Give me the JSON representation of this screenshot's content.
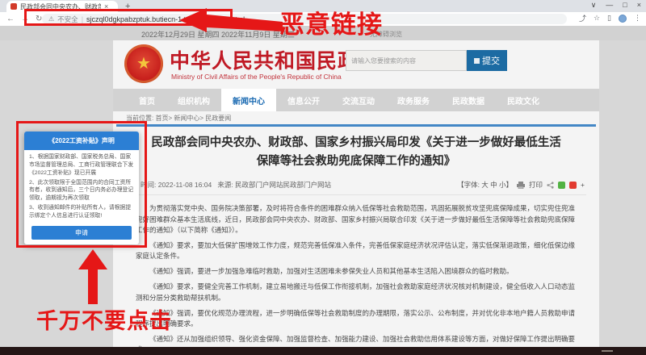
{
  "browser": {
    "tab": {
      "title": "民政部会同中央农办、财政部、",
      "close_icon": "×",
      "new_tab_icon": "+"
    },
    "window_controls": {
      "chevron": "∨",
      "minimize": "—",
      "maximize": "□",
      "close": "×"
    },
    "toolbar": {
      "back_icon": "←",
      "forward_icon": "→",
      "reload_icon": "↻",
      "warning_icon": "⚠",
      "security_label": "不安全",
      "divider": "|",
      "url": "sjczql0dgkpabzptuk.butiecn-1.top/gzbt/index.html",
      "share_icon": "⤴",
      "bookmark_icon": "☆",
      "sidebar_icon": "▯",
      "menu_icon": "⋮"
    }
  },
  "annotations": {
    "malicious_link": "恶意链接",
    "do_not_click": "千万不要点击"
  },
  "datebar": {
    "dates": "2022年12月29日 星期四 2022年11月9日 星期三",
    "accessibility_label": "无障碍浏览"
  },
  "site": {
    "emblem_star": "★",
    "title_cn": "中华人民共和国民政部",
    "title_en": "Ministry of Civil Affairs of the People's Republic of China",
    "search": {
      "placeholder": "请输入您要搜索的内容",
      "submit": "提交"
    }
  },
  "nav": {
    "items": [
      {
        "label": "首页"
      },
      {
        "label": "组织机构"
      },
      {
        "label": "新闻中心"
      },
      {
        "label": "信息公开"
      },
      {
        "label": "交流互动"
      },
      {
        "label": "政务服务"
      },
      {
        "label": "民政数据"
      },
      {
        "label": "民政文化"
      }
    ],
    "active_label": "新闻中心"
  },
  "breadcrumb": "当前位置: 首页> 新闻中心> 民政要闻",
  "article": {
    "title": "民政部会同中央农办、财政部、国家乡村振兴局印发《关于进一步做好最低生活保障等社会救助兜底保障工作的通知》",
    "time": "时间: 2022-11-08 16:04",
    "source": "来源: 民政部门户网站民政部门户网站",
    "font_size_label": "【字体: 大 中 小】",
    "print_label": "打印",
    "share_plus": "+",
    "paragraphs": [
      "为贯彻落实党中央、国务院决策部署，及时将符合条件的困难群众纳入低保等社会救助范围，巩固拓展脱贫攻坚兜底保障成果，切实兜住兜准兜好困难群众基本生活底线，近日，民政部会同中央农办、财政部、国家乡村振兴局联合印发《关于进一步做好最低生活保障等社会救助兜底保障工作的通知》（以下简称《通知》）。",
      "《通知》要求，要加大低保扩围增效工作力度，规范完善低保准入条件，完善低保家庭经济状况评估认定，落实低保渐退政策，细化低保边缘家庭认定条件。",
      "《通知》强调，要进一步加强急难临时救助，加强对生活困难未参保失业人员和其他基本生活陷入困境群众的临时救助。",
      "《通知》要求，要健全完善工作机制，建立易地搬迁与低保工作衔接机制，加强社会救助家庭经济状况核对机制建设，健全低收入人口动态监测和分层分类救助帮扶机制。",
      "《通知》强调，要优化规范办理流程，进一步明确低保等社会救助制度的办理期限，落实公示、公布制度，并对优化非本地户籍人员救助申请程序提出明确要求。",
      "《通知》还从加强组织领导、强化资金保障、加强监督检查、加强能力建设、加强社会救助信用体系建设等方面，对做好保障工作提出明确要求。"
    ]
  },
  "dialog": {
    "title": "《2022工资补贴》声明",
    "lines": [
      "1、根据国家财政部、国家税务总局、国家市场监督管理总局、工商行政管理联合下发《2022工资补贴》现已开展",
      "2、此次领取限于全国范围内的合同工资所有者，收到通知后，三个日内务必办理登记领取，逾期视为再次领取",
      "3、收到通知邮件的补贴所有人，请根据提示绑定个人信息进行认证领取!"
    ],
    "apply_button": "申请"
  },
  "colors": {
    "annotation_red": "#e51717",
    "site_red": "#c01a25",
    "nav_active_blue": "#1a6ab2",
    "dialog_blue": "#2c7fd4",
    "submit_blue": "#1c6ba3",
    "wechat_green": "#52b243",
    "weibo_red": "#e23b30"
  }
}
